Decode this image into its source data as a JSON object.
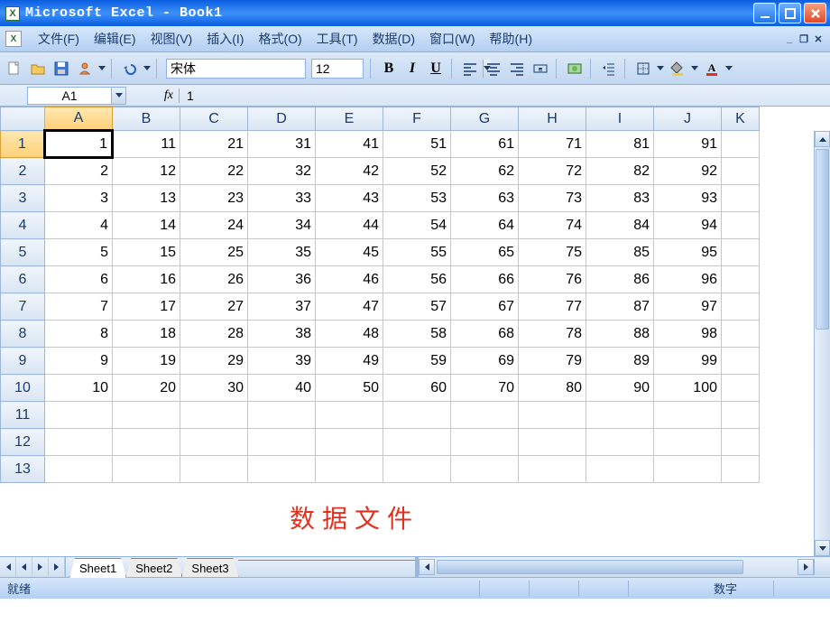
{
  "title": "Microsoft Excel - Book1",
  "menu": {
    "file": "文件(F)",
    "edit": "编辑(E)",
    "view": "视图(V)",
    "insert": "插入(I)",
    "format": "格式(O)",
    "tools": "工具(T)",
    "data": "数据(D)",
    "window": "窗口(W)",
    "help": "帮助(H)"
  },
  "toolbar": {
    "font_name": "宋体",
    "font_size": "12"
  },
  "formula": {
    "active_cell": "A1",
    "fx_label": "fx",
    "value": "1"
  },
  "columns": [
    "A",
    "B",
    "C",
    "D",
    "E",
    "F",
    "G",
    "H",
    "I",
    "J",
    "K"
  ],
  "active_col": "A",
  "active_row": 1,
  "row_count": 13,
  "cells": {
    "r1": [
      "1",
      "11",
      "21",
      "31",
      "41",
      "51",
      "61",
      "71",
      "81",
      "91",
      ""
    ],
    "r2": [
      "2",
      "12",
      "22",
      "32",
      "42",
      "52",
      "62",
      "72",
      "82",
      "92",
      ""
    ],
    "r3": [
      "3",
      "13",
      "23",
      "33",
      "43",
      "53",
      "63",
      "73",
      "83",
      "93",
      ""
    ],
    "r4": [
      "4",
      "14",
      "24",
      "34",
      "44",
      "54",
      "64",
      "74",
      "84",
      "94",
      ""
    ],
    "r5": [
      "5",
      "15",
      "25",
      "35",
      "45",
      "55",
      "65",
      "75",
      "85",
      "95",
      ""
    ],
    "r6": [
      "6",
      "16",
      "26",
      "36",
      "46",
      "56",
      "66",
      "76",
      "86",
      "96",
      ""
    ],
    "r7": [
      "7",
      "17",
      "27",
      "37",
      "47",
      "57",
      "67",
      "77",
      "87",
      "97",
      ""
    ],
    "r8": [
      "8",
      "18",
      "28",
      "38",
      "48",
      "58",
      "68",
      "78",
      "88",
      "98",
      ""
    ],
    "r9": [
      "9",
      "19",
      "29",
      "39",
      "49",
      "59",
      "69",
      "79",
      "89",
      "99",
      ""
    ],
    "r10": [
      "10",
      "20",
      "30",
      "40",
      "50",
      "60",
      "70",
      "80",
      "90",
      "100",
      ""
    ],
    "r11": [
      "",
      "",
      "",
      "",
      "",
      "",
      "",
      "",
      "",
      "",
      ""
    ],
    "r12": [
      "",
      "",
      "",
      "",
      "",
      "",
      "",
      "",
      "",
      "",
      ""
    ],
    "r13": [
      "",
      "",
      "",
      "",
      "",
      "",
      "",
      "",
      "",
      "",
      ""
    ]
  },
  "overlay_text": "数据文件",
  "sheets": {
    "s1": "Sheet1",
    "s2": "Sheet2",
    "s3": "Sheet3",
    "active": "Sheet1"
  },
  "status": {
    "ready": "就绪",
    "num": "数字"
  }
}
